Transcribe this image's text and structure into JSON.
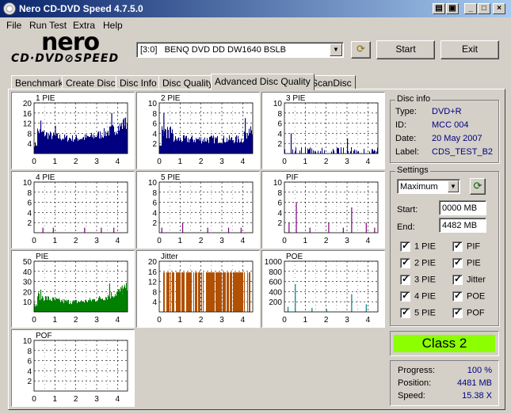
{
  "window": {
    "title": "Nero CD-DVD Speed 4.7.5.0"
  },
  "menu": [
    "File",
    "Run Test",
    "Extra",
    "Help"
  ],
  "logo": {
    "line1": "nero",
    "line2": "CD·DVD⊘SPEED"
  },
  "drive": {
    "selected": "[3:0]   BENQ DVD DD DW1640 BSLB"
  },
  "buttons": {
    "start": "Start",
    "exit": "Exit"
  },
  "tabs": [
    "Benchmark",
    "Create Disc",
    "Disc Info",
    "Disc Quality",
    "Advanced Disc Quality",
    "ScanDisc"
  ],
  "active_tab": 4,
  "disc_info": {
    "legend": "Disc info",
    "type_label": "Type:",
    "type": "DVD+R",
    "id_label": "ID:",
    "id": "MCC 004",
    "date_label": "Date:",
    "date": "20 May 2007",
    "label_label": "Label:",
    "label": "CDS_TEST_B2"
  },
  "settings": {
    "legend": "Settings",
    "speed": "Maximum",
    "start_label": "Start:",
    "start": "0000 MB",
    "end_label": "End:",
    "end": "4482 MB",
    "checks_left": [
      "1 PIE",
      "2 PIE",
      "3 PIE",
      "4 PIE",
      "5 PIE"
    ],
    "checks_right": [
      "PIF",
      "PIE",
      "Jitter",
      "POE",
      "POF"
    ]
  },
  "class_result": "Class 2",
  "progress": {
    "progress_label": "Progress:",
    "progress": "100 %",
    "position_label": "Position:",
    "position": "4481 MB",
    "speed_label": "Speed:",
    "speed": "15.38 X"
  },
  "chart_data": [
    {
      "type": "bar",
      "title": "1 PIE",
      "color": "#000080",
      "yticks": [
        4,
        8,
        12,
        16,
        20
      ],
      "ylim": [
        0,
        20
      ],
      "xticks": [
        0,
        1,
        2,
        3,
        4
      ],
      "xlim": [
        0,
        4.48
      ],
      "profile": "ushape",
      "level": [
        0.42,
        0.3,
        0.62
      ],
      "spikes": [
        [
          0.3,
          13
        ],
        [
          1.0,
          11
        ],
        [
          3.7,
          16
        ],
        [
          4.3,
          14
        ]
      ]
    },
    {
      "type": "bar",
      "title": "2 PIE",
      "color": "#000080",
      "yticks": [
        2,
        4,
        6,
        8,
        10
      ],
      "ylim": [
        0,
        10
      ],
      "xticks": [
        0,
        1,
        2,
        3,
        4
      ],
      "xlim": [
        0,
        4.48
      ],
      "profile": "block",
      "level": [
        0.28,
        0.18,
        0.42
      ],
      "spikes": [
        [
          0.2,
          8
        ],
        [
          4.1,
          7
        ]
      ]
    },
    {
      "type": "bar",
      "title": "3 PIE",
      "color": "#000080",
      "yticks": [
        2,
        4,
        6,
        8,
        10
      ],
      "ylim": [
        0,
        10
      ],
      "xticks": [
        0,
        1,
        2,
        3,
        4
      ],
      "xlim": [
        0,
        4.48
      ],
      "profile": "sparse",
      "level": [
        0.06,
        0.03,
        0.08
      ],
      "spikes": [
        [
          0.3,
          4
        ],
        [
          3.0,
          3
        ]
      ]
    },
    {
      "type": "bar",
      "title": "4 PIE",
      "color": "#800080",
      "yticks": [
        2,
        4,
        6,
        8,
        10
      ],
      "ylim": [
        0,
        10
      ],
      "xticks": [
        0,
        1,
        2,
        3,
        4
      ],
      "xlim": [
        0,
        4.48
      ],
      "profile": "rare",
      "level": [
        0,
        0,
        0
      ],
      "spikes": [
        [
          0.4,
          1
        ],
        [
          0.9,
          1
        ],
        [
          2.4,
          1
        ],
        [
          3.2,
          1
        ],
        [
          3.8,
          1
        ]
      ]
    },
    {
      "type": "bar",
      "title": "5 PIE",
      "color": "#800080",
      "yticks": [
        2,
        4,
        6,
        8,
        10
      ],
      "ylim": [
        0,
        10
      ],
      "xticks": [
        0,
        1,
        2,
        3,
        4
      ],
      "xlim": [
        0,
        4.48
      ],
      "profile": "rare",
      "level": [
        0,
        0,
        0
      ],
      "spikes": [
        [
          0.1,
          1
        ],
        [
          1.1,
          2
        ],
        [
          2.3,
          1
        ],
        [
          3.3,
          1
        ],
        [
          3.9,
          1
        ]
      ]
    },
    {
      "type": "bar",
      "title": "PIF",
      "color": "#800080",
      "yticks": [
        2,
        4,
        6,
        8,
        10
      ],
      "ylim": [
        0,
        10
      ],
      "xticks": [
        0,
        1,
        2,
        3,
        4
      ],
      "xlim": [
        0,
        4.48
      ],
      "profile": "rare",
      "level": [
        0,
        0,
        0
      ],
      "spikes": [
        [
          0.2,
          2
        ],
        [
          0.55,
          6
        ],
        [
          1.2,
          1
        ],
        [
          2.1,
          2
        ],
        [
          2.8,
          1
        ],
        [
          3.2,
          5
        ],
        [
          3.9,
          2
        ],
        [
          4.3,
          1
        ]
      ]
    },
    {
      "type": "bar",
      "title": "PIE",
      "color": "#008000",
      "yticks": [
        10,
        20,
        30,
        40,
        50
      ],
      "ylim": [
        0,
        50
      ],
      "xticks": [
        0,
        1,
        2,
        3,
        4
      ],
      "xlim": [
        0,
        4.48
      ],
      "profile": "ushape",
      "level": [
        0.36,
        0.2,
        0.48
      ],
      "spikes": [
        [
          0.3,
          22
        ],
        [
          3.6,
          28
        ],
        [
          4.2,
          26
        ]
      ]
    },
    {
      "type": "bar",
      "title": "Jitter",
      "color": "#b05000",
      "yticks": [
        4,
        8,
        12,
        16,
        20
      ],
      "ylim": [
        0,
        20
      ],
      "xticks": [
        0,
        1,
        2,
        3,
        4
      ],
      "xlim": [
        0,
        4.48
      ],
      "profile": "jitter",
      "level": [
        0.5,
        0.5,
        0.5
      ],
      "spikes": []
    },
    {
      "type": "bar",
      "title": "POE",
      "color": "#008080",
      "yticks": [
        200,
        400,
        600,
        800,
        1000
      ],
      "ylim": [
        0,
        1000
      ],
      "xticks": [
        0,
        1,
        2,
        3,
        4
      ],
      "xlim": [
        0,
        4.48
      ],
      "profile": "rare",
      "level": [
        0,
        0,
        0
      ],
      "spikes": [
        [
          0.15,
          100
        ],
        [
          0.5,
          550
        ],
        [
          1.3,
          80
        ],
        [
          2.0,
          60
        ],
        [
          3.2,
          350
        ],
        [
          3.9,
          150
        ]
      ]
    },
    {
      "type": "bar",
      "title": "POF",
      "color": "#800080",
      "yticks": [
        2,
        4,
        6,
        8,
        10
      ],
      "ylim": [
        0,
        10
      ],
      "xticks": [
        0,
        1,
        2,
        3,
        4
      ],
      "xlim": [
        0,
        4.48
      ],
      "profile": "none",
      "level": [
        0,
        0,
        0
      ],
      "spikes": []
    }
  ]
}
